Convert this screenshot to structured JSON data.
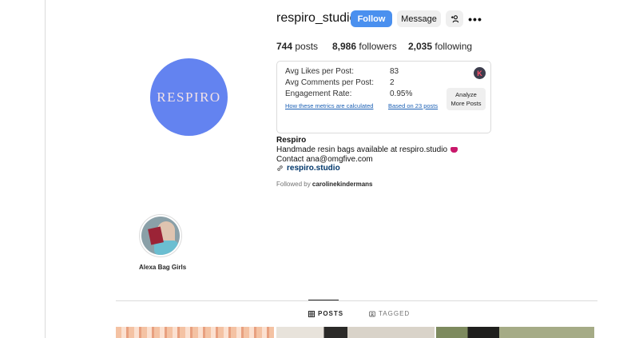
{
  "profile": {
    "username": "respiro_studio",
    "avatar_text": "RESPIRO",
    "follow_label": "Follow",
    "message_label": "Message",
    "more_label": "•••",
    "posts_count": "744",
    "posts_label": "posts",
    "followers_count": "8,986",
    "followers_label": "followers",
    "following_count": "2,035",
    "following_label": "following"
  },
  "metrics": {
    "avg_likes_label": "Avg Likes per Post:",
    "avg_likes_value": "83",
    "avg_comments_label": "Avg Comments per Post:",
    "avg_comments_value": "2",
    "engagement_label": "Engagement Rate:",
    "engagement_value": "0.95%",
    "how_link": "How these metrics are calculated",
    "based_on_link": "Based on 23 posts",
    "analyze_label_1": "Analyze",
    "analyze_label_2": "More Posts",
    "badge_letter": "K"
  },
  "bio": {
    "name": "Respiro",
    "line1": "Handmade resin bags available at respiro.studio",
    "line2": "Contact ana@omgfive.com",
    "link": "respiro.studio",
    "followed_by_prefix": "Followed by",
    "followed_by_user": "carolinekindermans"
  },
  "highlights": [
    {
      "label": "Alexa Bag Girls"
    }
  ],
  "tabs": [
    {
      "label": "POSTS",
      "active": true
    },
    {
      "label": "TAGGED",
      "active": false
    }
  ],
  "colors": {
    "follow_blue": "#4a90ef",
    "avatar_blue": "#6383f0",
    "link_blue": "#1a5fb4"
  }
}
